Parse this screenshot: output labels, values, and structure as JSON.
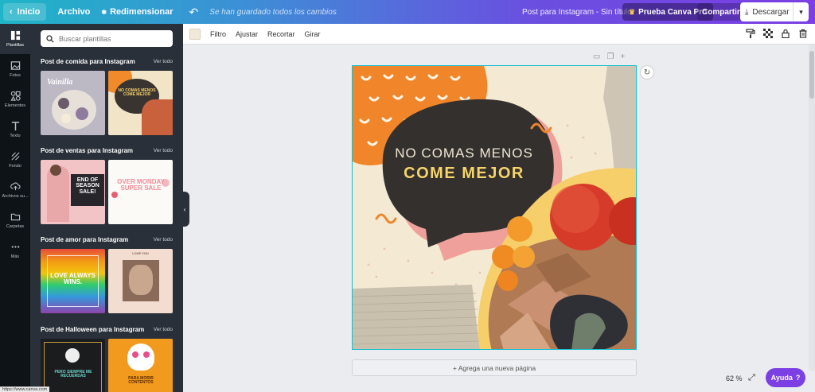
{
  "topbar": {
    "home": "Inicio",
    "file": "Archivo",
    "resize": "Redimensionar",
    "saved_status": "Se han guardado todos los cambios",
    "doc_title": "Post para Instagram - Sin título",
    "pro_button": "Prueba Canva Pro",
    "share": "Compartir",
    "download": "Descargar"
  },
  "rail": [
    {
      "label": "Plantillas",
      "icon": "templates-icon"
    },
    {
      "label": "Fotos",
      "icon": "photos-icon"
    },
    {
      "label": "Elementos",
      "icon": "elements-icon"
    },
    {
      "label": "Texto",
      "icon": "text-icon"
    },
    {
      "label": "Fondo",
      "icon": "background-icon"
    },
    {
      "label": "Archivos su...",
      "icon": "upload-icon"
    },
    {
      "label": "Carpetas",
      "icon": "folder-icon"
    },
    {
      "label": "Más",
      "icon": "more-icon"
    }
  ],
  "search": {
    "placeholder": "Buscar plantillas"
  },
  "sections": [
    {
      "title": "Post de comida para Instagram",
      "more": "Ver todo",
      "thumbs": [
        {
          "text": "Vainilla"
        },
        {
          "text": "NO COMAS MENOS COME MEJOR"
        }
      ]
    },
    {
      "title": "Post de ventas para Instagram",
      "more": "Ver todo",
      "thumbs": [
        {
          "text": "END OF SEASON SALE!"
        },
        {
          "text": "OVER MONDAY SUPER SALE"
        }
      ]
    },
    {
      "title": "Post de amor para Instagram",
      "more": "Ver todo",
      "thumbs": [
        {
          "text": "LOVE ALWAYS WINS."
        },
        {
          "text": "LOVE YOU"
        }
      ]
    },
    {
      "title": "Post de Halloween para Instagram",
      "more": "Ver todo",
      "thumbs": [
        {
          "text": "PERO SIEMPRE ME RECUERDAS"
        },
        {
          "text": "PARA MORIR CONTENTOS"
        }
      ]
    }
  ],
  "toolbar": {
    "filter": "Filtro",
    "adjust": "Ajustar",
    "crop": "Recortar",
    "flip": "Girar",
    "swatch_color": "#f2ead7"
  },
  "design": {
    "line1": "NO COMAS MENOS",
    "line2": "COME MEJOR"
  },
  "add_page": "+ Agrega una nueva página",
  "zoom": "62 %",
  "help": "Ayuda",
  "status_url": "https://www.canva.com"
}
